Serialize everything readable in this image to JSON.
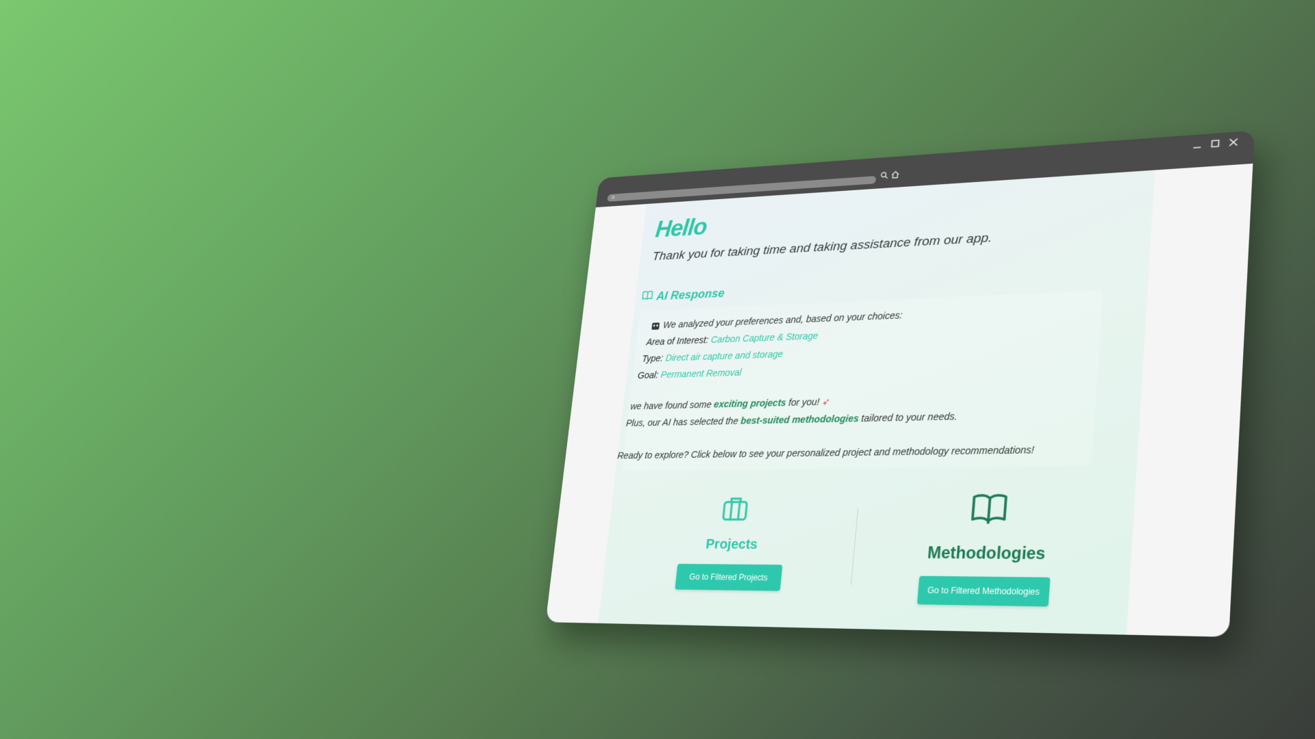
{
  "window": {
    "controls": [
      "minimize-icon",
      "maximize-icon",
      "close-icon"
    ],
    "toolbar_icons": [
      "search-icon",
      "home-icon"
    ]
  },
  "greeting": {
    "title": "Hello",
    "subtitle": "Thank you for taking time and taking assistance from our app."
  },
  "ai_response": {
    "header": "AI Response",
    "intro": "We analyzed your preferences and, based on your choices:",
    "area_label": "Area of Interest:",
    "area_value": "Carbon Capture & Storage",
    "type_label": "Type:",
    "type_value": "Direct air capture and storage",
    "goal_label": "Goal:",
    "goal_value": "Permanent Removal",
    "found_prefix": "we have found some",
    "found_highlight": "exciting projects",
    "found_suffix": "for you!",
    "plus_prefix": "Plus, our AI has selected the",
    "plus_highlight": "best-suited methodologies",
    "plus_suffix": "tailored to your needs.",
    "cta": "Ready to explore? Click below to see your personalized project and methodology recommendations!"
  },
  "cards": {
    "projects": {
      "title": "Projects",
      "button": "Go to Filtered Projects",
      "icon": "briefcase-icon"
    },
    "methodologies": {
      "title": "Methodologies",
      "button": "Go to Filtered Methodologies",
      "icon": "book-open-icon"
    }
  },
  "colors": {
    "accent": "#2ec7a7",
    "accent_dark": "#1c7a54",
    "button": "#2ec9ad"
  }
}
